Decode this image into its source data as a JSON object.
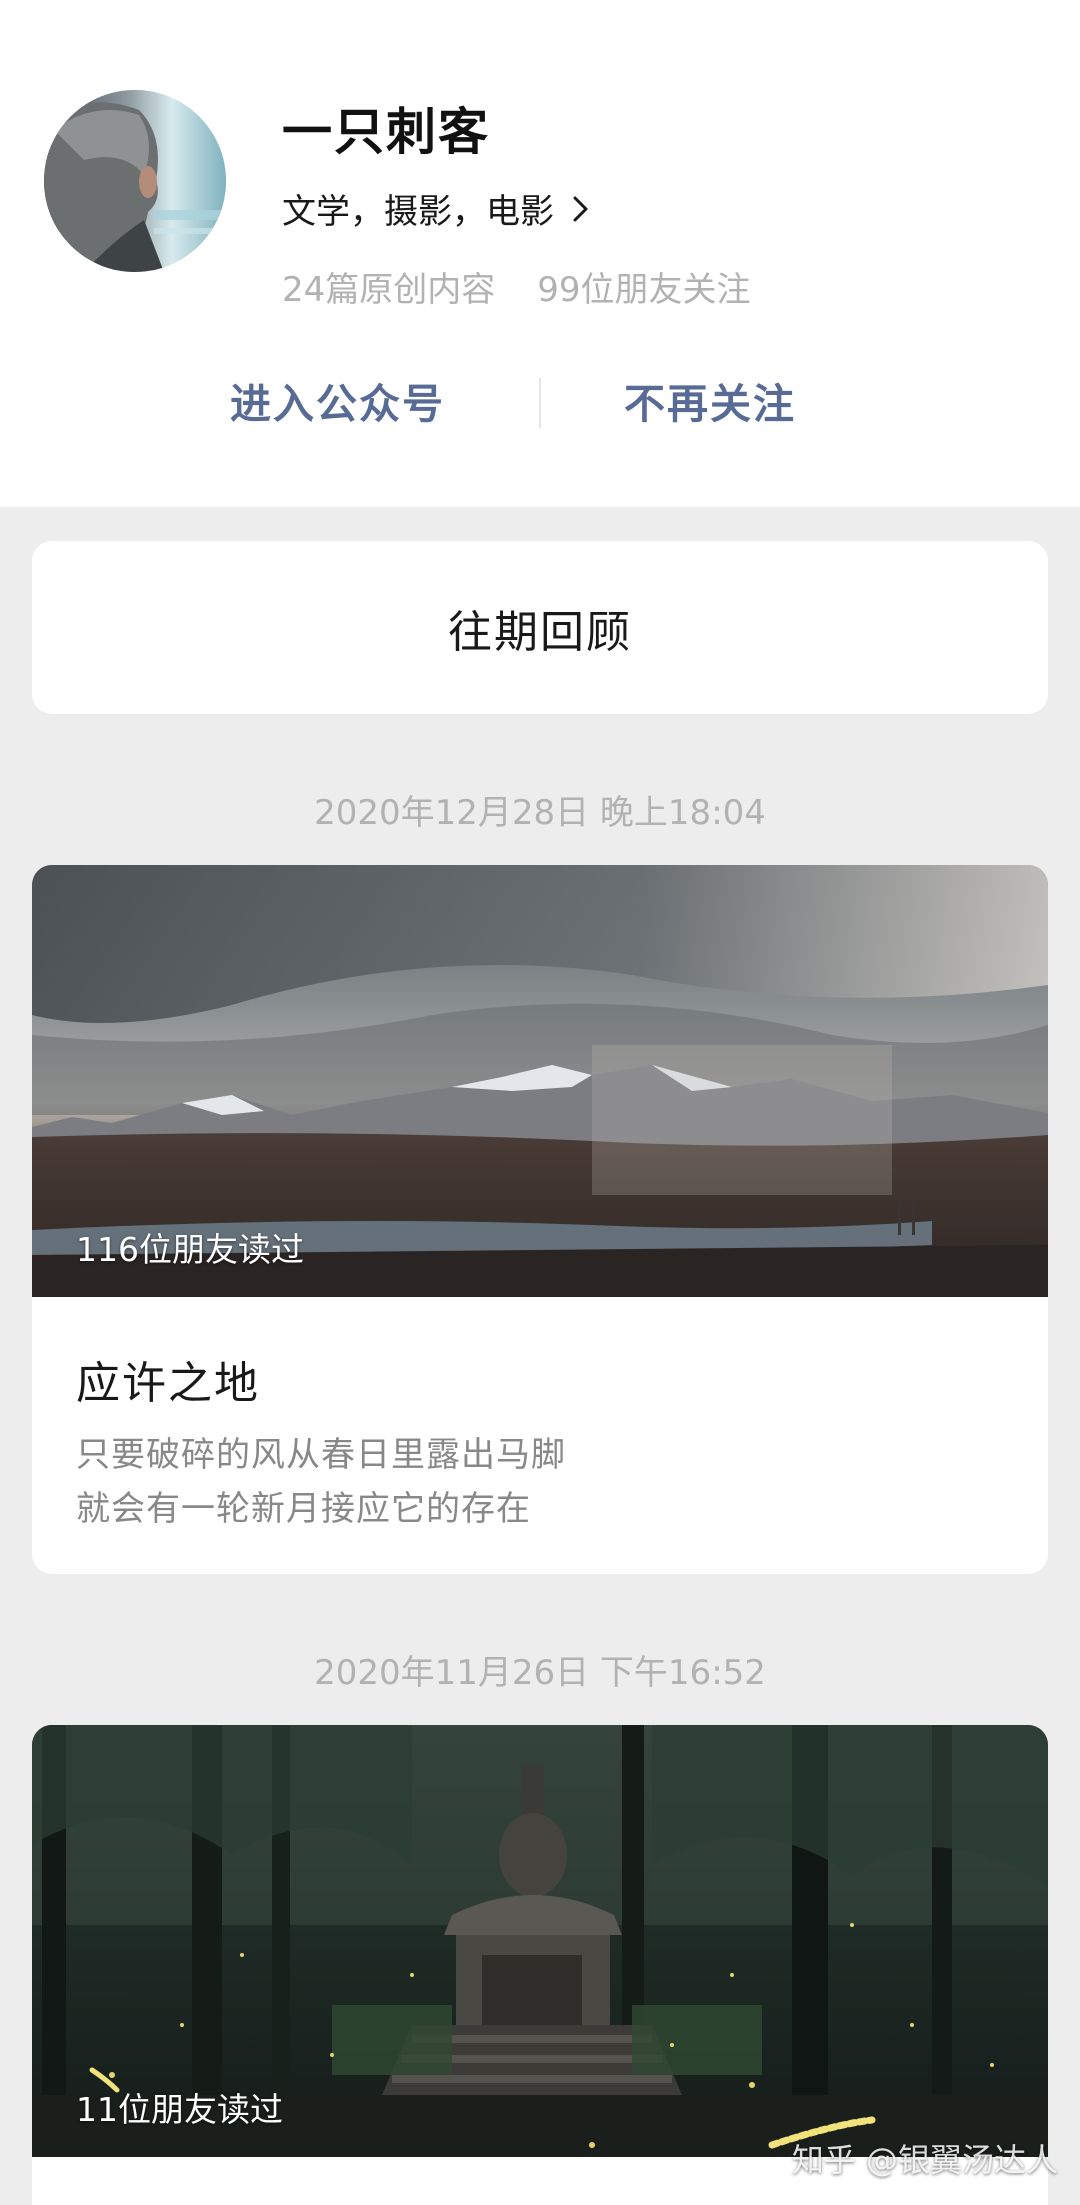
{
  "profile": {
    "name": "一只刺客",
    "tags": "文学，摄影，电影",
    "original_count": "24篇原创内容",
    "friends_following": "99位朋友关注"
  },
  "actions": {
    "enter": "进入公众号",
    "unfollow": "不再关注"
  },
  "review": {
    "label": "往期回顾"
  },
  "articles": [
    {
      "date": "2020年12月28日 晚上18:04",
      "read_count": "116位朋友读过",
      "title": "应许之地",
      "desc_line1": "只要破碎的风从春日里露出马脚",
      "desc_line2": "就会有一轮新月接应它的存在"
    },
    {
      "date": "2020年11月26日 下午16:52",
      "read_count": "11位朋友读过",
      "title": "",
      "desc_line1": "",
      "desc_line2": ""
    }
  ],
  "watermark": "知乎 @银翼汤达人",
  "colors": {
    "accent": "#576b95",
    "background": "#ededed",
    "muted_text": "#b2b2b2"
  },
  "icons": {
    "tags_arrow": "chevron-right-icon"
  }
}
